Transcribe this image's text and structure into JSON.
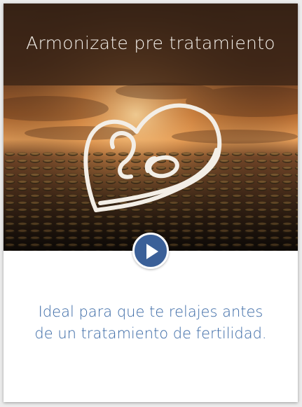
{
  "header": {
    "title": "Armonizate pre tratamiento"
  },
  "hero": {
    "background_description_icon": "sunset-lily-pads-image",
    "emblem_icon": "heart-icon",
    "emblem_color": "#f3eee6"
  },
  "player": {
    "play_icon": "play-icon",
    "button_color": "#3b6098"
  },
  "description": {
    "line1": "Ideal para que te relajes antes",
    "line2": "de un tratamiento de fertilidad.",
    "color": "#3b6aa6"
  }
}
